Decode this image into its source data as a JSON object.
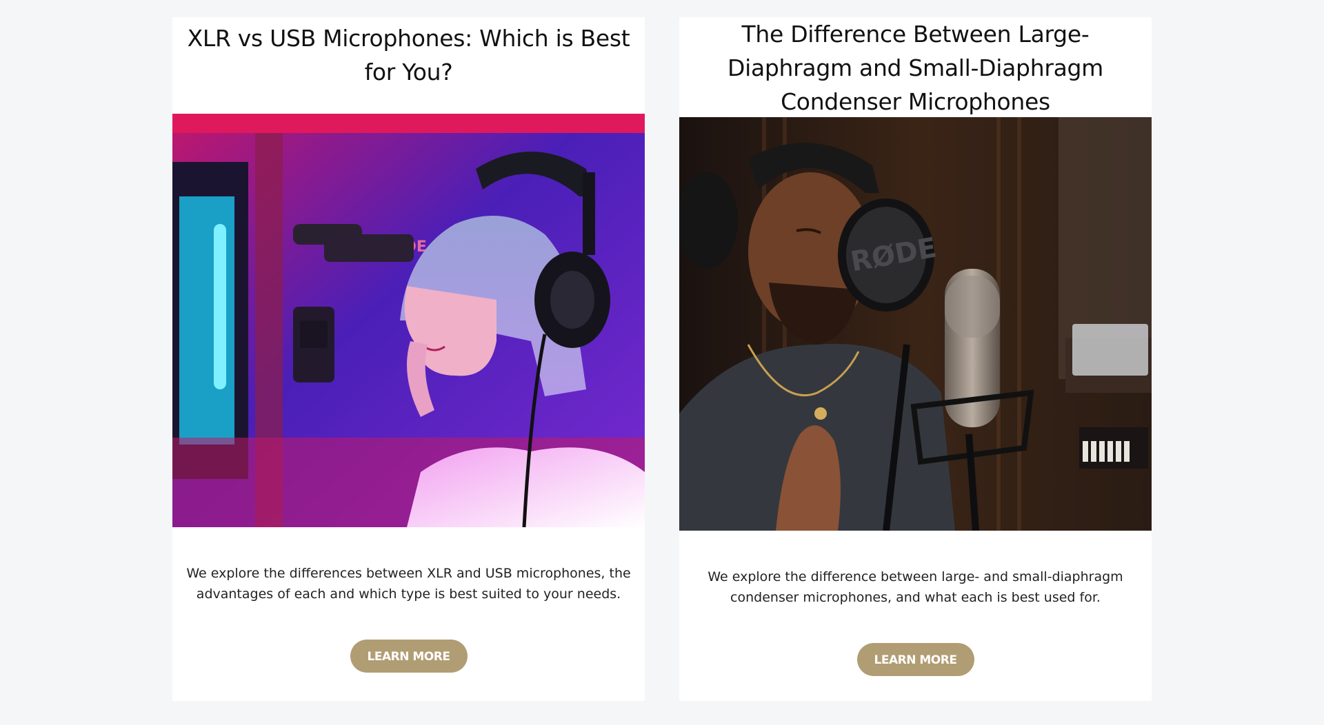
{
  "cards": [
    {
      "title": "XLR vs USB Microphones: Which is Best for You?",
      "image_logo_text": "RØDE",
      "description": "We explore the differences between XLR and USB microphones, the advantages of each and which type is best suited to your needs.",
      "button_label": "LEARN MORE"
    },
    {
      "title": "The Difference Between Large-Diaphragm and Small-Diaphragm Condenser Microphones",
      "image_logo_text": "RØDE",
      "description": "We explore the difference between large- and small-diaphragm condenser microphones, and what each is best used for.",
      "button_label": "LEARN MORE"
    }
  ],
  "colors": {
    "page_background": "#f5f6f8",
    "card_background": "#ffffff",
    "button_background": "#b19d73",
    "button_text": "#ffffff",
    "title_text": "#111111"
  }
}
